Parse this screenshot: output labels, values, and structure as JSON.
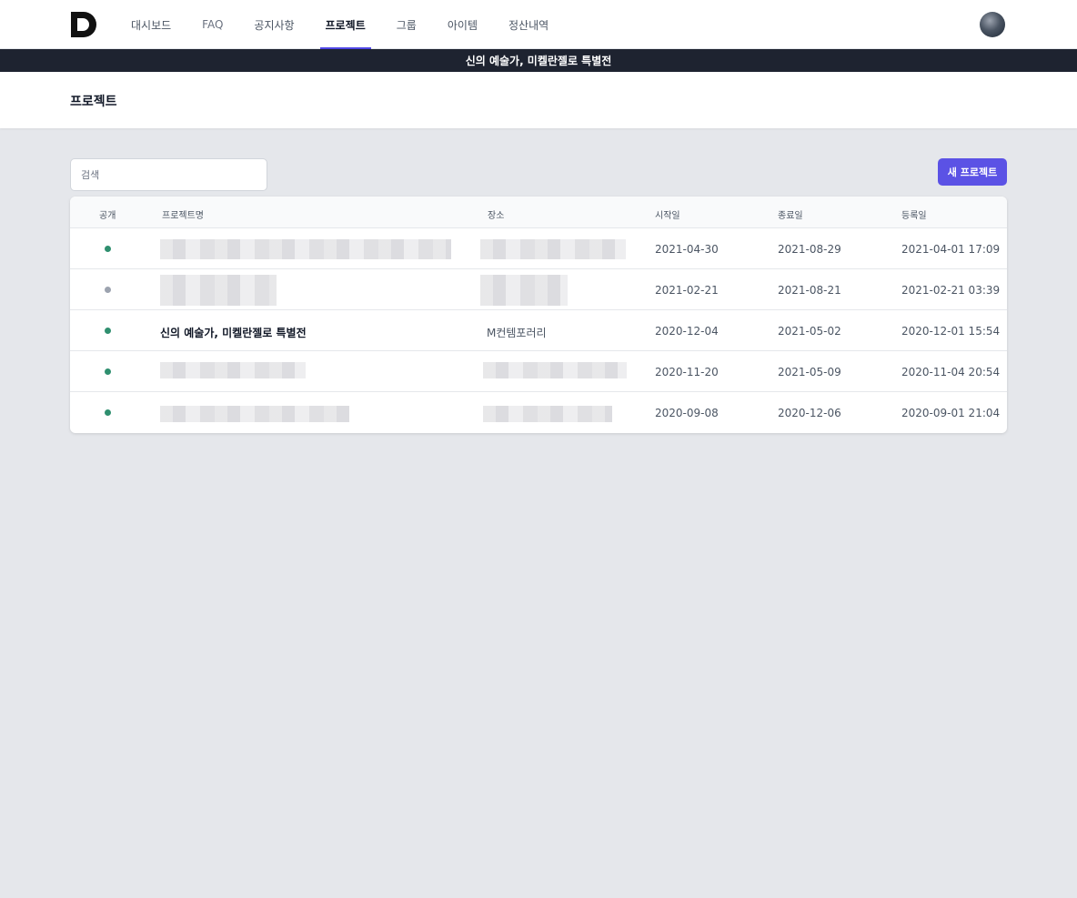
{
  "nav": {
    "items": [
      {
        "label": "대시보드",
        "active": false
      },
      {
        "label": "FAQ",
        "active": false
      },
      {
        "label": "공지사항",
        "active": false
      },
      {
        "label": "프로젝트",
        "active": true
      },
      {
        "label": "그룹",
        "active": false
      },
      {
        "label": "아이템",
        "active": false
      },
      {
        "label": "정산내역",
        "active": false
      }
    ]
  },
  "banner": {
    "text": "신의 예술가, 미켈란젤로 특별전"
  },
  "page": {
    "title": "프로젝트"
  },
  "toolbar": {
    "search_placeholder": "검색",
    "new_project_label": "새 프로젝트"
  },
  "table": {
    "headers": {
      "public": "공개",
      "name": "프로젝트명",
      "place": "장소",
      "start": "시작일",
      "end": "종료일",
      "registered": "등록일"
    },
    "rows": [
      {
        "public": true,
        "name": "",
        "place": "",
        "start": "2021-04-30",
        "end": "2021-08-29",
        "registered": "2021-04-01 17:09"
      },
      {
        "public": false,
        "name": "",
        "place": "",
        "start": "2021-02-21",
        "end": "2021-08-21",
        "registered": "2021-02-21 03:39"
      },
      {
        "public": true,
        "name": "신의 예술가, 미켈란젤로 특별전",
        "place": "M컨템포러리",
        "start": "2020-12-04",
        "end": "2021-05-02",
        "registered": "2020-12-01 15:54"
      },
      {
        "public": true,
        "name": "",
        "place": "",
        "start": "2020-11-20",
        "end": "2021-05-09",
        "registered": "2020-11-04 20:54"
      },
      {
        "public": true,
        "name": "",
        "place": "",
        "start": "2020-09-08",
        "end": "2020-12-06",
        "registered": "2020-09-01 21:04"
      }
    ]
  },
  "colors": {
    "accent": "#5b52e5",
    "public_dot": "#2f8f6f",
    "private_dot": "#9ca3af",
    "banner_bg": "#1e2330"
  },
  "icons": {
    "logo": "d-logo-icon",
    "avatar": "user-avatar"
  }
}
